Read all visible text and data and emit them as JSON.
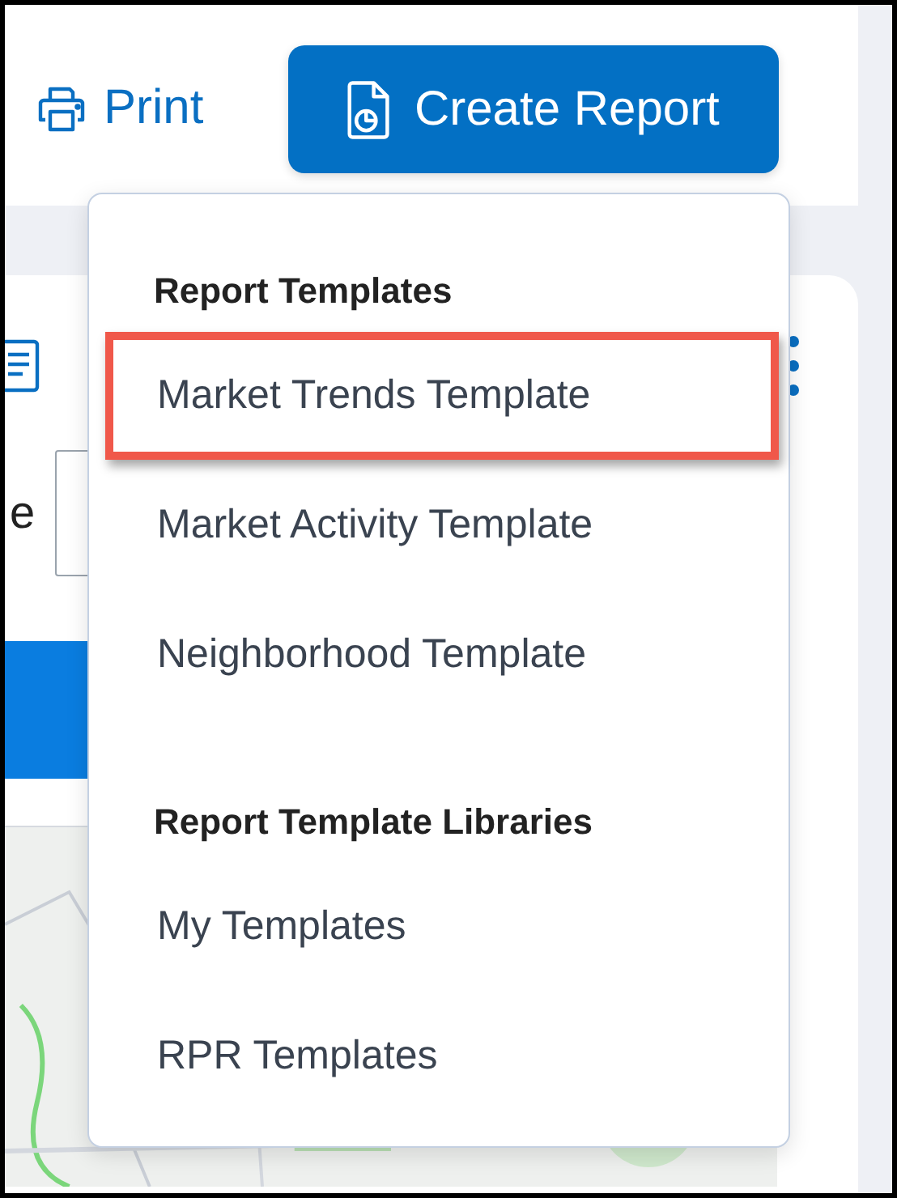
{
  "toolbar": {
    "print_label": "Print",
    "create_report_label": "Create Report"
  },
  "background": {
    "cut_label": "e"
  },
  "dropdown": {
    "sections": [
      {
        "heading": "Report Templates",
        "items": [
          {
            "label": "Market Trends Template",
            "highlighted": true
          },
          {
            "label": "Market Activity Template",
            "highlighted": false
          },
          {
            "label": "Neighborhood Template",
            "highlighted": false
          }
        ]
      },
      {
        "heading": "Report Template Libraries",
        "items": [
          {
            "label": "My Templates",
            "highlighted": false
          },
          {
            "label": "RPR Templates",
            "highlighted": false
          }
        ]
      }
    ]
  }
}
